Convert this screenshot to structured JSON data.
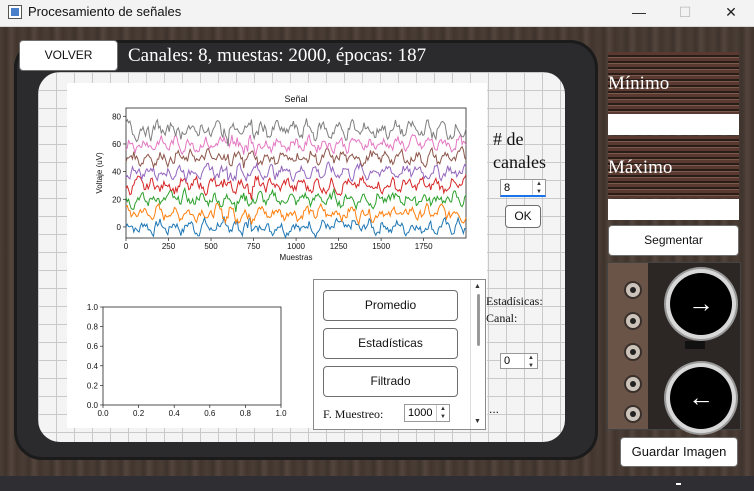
{
  "window": {
    "title": "Procesamiento de señales",
    "minimize": "—",
    "maximize": "☐",
    "close": "✕"
  },
  "header": {
    "back_button": "VOLVER",
    "info": "Canales: 8, muestas: 2000, épocas: 187"
  },
  "channels": {
    "label_line1": "# de",
    "label_line2": "canales",
    "value": "8",
    "ok_button": "OK"
  },
  "segment": {
    "min_label": "Mínimo",
    "max_label": "Máximo",
    "min_value": "",
    "max_value": "",
    "segment_button": "Segmentar"
  },
  "reels": {
    "forward_icon": "→",
    "back_icon": "←"
  },
  "save_button": "Guardar Imagen",
  "stats": {
    "title": "Estadísicas:",
    "channel_label": "Canal:",
    "channel_value": "0",
    "ellipsis": "..."
  },
  "actions": {
    "promedio": "Promedio",
    "estadisticas": "Estadísticas",
    "filtrado": "Filtrado",
    "sampling_label": "F. Muestreo:",
    "sampling_value": "1000"
  },
  "chart_data": [
    {
      "type": "line",
      "title": "Señal",
      "xlabel": "Muestras",
      "ylabel": "Voltaje (uV)",
      "xlim": [
        0,
        1999
      ],
      "ylim": [
        -8,
        86
      ],
      "xticks": [
        0,
        250,
        500,
        750,
        1000,
        1250,
        1500,
        1750
      ],
      "yticks": [
        0,
        20,
        40,
        60,
        80
      ],
      "series": [
        {
          "offset": 0,
          "amplitude": 5,
          "color": "#1f77b4"
        },
        {
          "offset": 10,
          "amplitude": 5,
          "color": "#ff7f0e"
        },
        {
          "offset": 20,
          "amplitude": 5,
          "color": "#2ca02c"
        },
        {
          "offset": 30,
          "amplitude": 5,
          "color": "#d62728"
        },
        {
          "offset": 40,
          "amplitude": 5,
          "color": "#9467bd"
        },
        {
          "offset": 50,
          "amplitude": 5,
          "color": "#8c564b"
        },
        {
          "offset": 60,
          "amplitude": 5,
          "color": "#e377c2"
        },
        {
          "offset": 70,
          "amplitude": 6,
          "color": "#7f7f7f"
        }
      ]
    },
    {
      "type": "line",
      "title": "",
      "xlim": [
        0,
        1
      ],
      "ylim": [
        0,
        1
      ],
      "xticks": [
        "0.0",
        "0.2",
        "0.4",
        "0.6",
        "0.8",
        "1.0"
      ],
      "yticks": [
        "0.0",
        "0.2",
        "0.4",
        "0.6",
        "0.8",
        "1.0"
      ],
      "series": []
    }
  ]
}
